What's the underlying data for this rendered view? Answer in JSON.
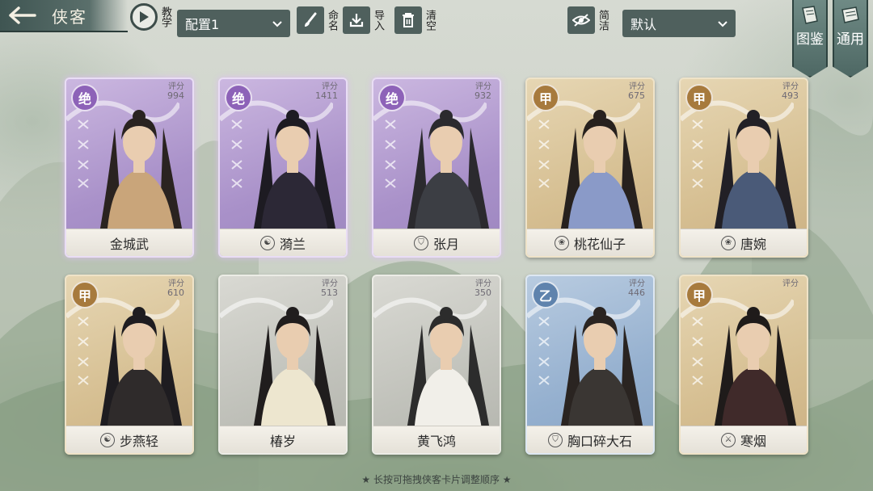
{
  "header": {
    "title": "侠客",
    "tutorial_label": "教学",
    "config_value": "配置1",
    "rename_label": "命名",
    "import_label": "导入",
    "clear_label": "清空",
    "simple_label": "简洁",
    "sort_value": "默认"
  },
  "side_tabs": [
    {
      "label": "图鉴"
    },
    {
      "label": "通用"
    }
  ],
  "score_label": "评分",
  "cards": [
    {
      "name": "金城武",
      "grade": "绝",
      "tier": "jue",
      "score": "994",
      "sect_icon": "none-icon"
    },
    {
      "name": "漪兰",
      "grade": "绝",
      "tier": "jue",
      "score": "1411",
      "sect_icon": "yinyang-icon"
    },
    {
      "name": "张月",
      "grade": "绝",
      "tier": "jue",
      "score": "932",
      "sect_icon": "shield-icon"
    },
    {
      "name": "桃花仙子",
      "grade": "甲",
      "tier": "jia",
      "score": "675",
      "sect_icon": "lotus-icon"
    },
    {
      "name": "唐婉",
      "grade": "甲",
      "tier": "jia",
      "score": "493",
      "sect_icon": "lotus-icon"
    },
    {
      "name": "步燕轻",
      "grade": "甲",
      "tier": "jia",
      "score": "610",
      "sect_icon": "yinyang-icon"
    },
    {
      "name": "椿岁",
      "grade": "",
      "tier": "none",
      "score": "513",
      "sect_icon": "none-icon"
    },
    {
      "name": "黄飞鸿",
      "grade": "",
      "tier": "none",
      "score": "350",
      "sect_icon": "none-icon"
    },
    {
      "name": "胸口碎大石",
      "grade": "乙",
      "tier": "yi",
      "score": "446",
      "sect_icon": "shield-icon"
    },
    {
      "name": "寒烟",
      "grade": "甲",
      "tier": "jia",
      "score": "",
      "sect_icon": "sword-icon"
    }
  ],
  "footer": {
    "hint": "★ 长按可拖拽侠客卡片调整顺序 ★"
  }
}
